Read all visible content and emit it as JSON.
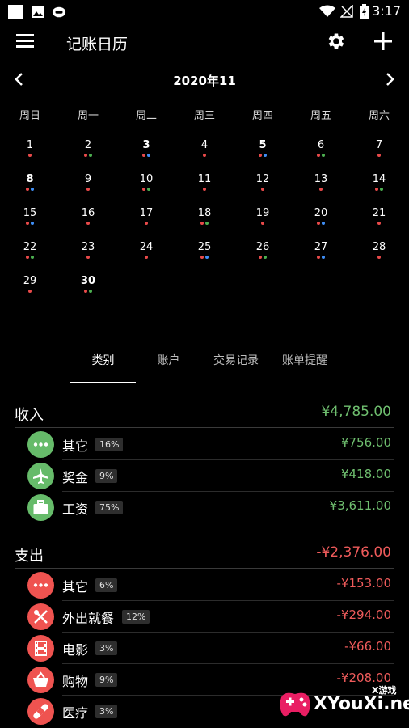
{
  "status_bar": {
    "time": "3:17"
  },
  "header": {
    "title": "记账日历"
  },
  "month_label": "2020年11",
  "weekdays": [
    "周日",
    "周一",
    "周二",
    "周三",
    "周四",
    "周五",
    "周六"
  ],
  "calendar": [
    {
      "day": "1",
      "dots": [
        "r"
      ]
    },
    {
      "day": "2",
      "dots": [
        "r",
        "g"
      ]
    },
    {
      "day": "3",
      "dots": [
        "r",
        "b"
      ],
      "bold": true
    },
    {
      "day": "4",
      "dots": [
        "r"
      ]
    },
    {
      "day": "5",
      "dots": [
        "r",
        "b"
      ],
      "bold": true
    },
    {
      "day": "6",
      "dots": [
        "r",
        "g"
      ]
    },
    {
      "day": "7",
      "dots": [
        "r"
      ]
    },
    {
      "day": "8",
      "dots": [
        "r",
        "b"
      ],
      "bold": true
    },
    {
      "day": "9",
      "dots": [
        "r"
      ]
    },
    {
      "day": "10",
      "dots": [
        "r",
        "g"
      ]
    },
    {
      "day": "11",
      "dots": [
        "r"
      ]
    },
    {
      "day": "12",
      "dots": [
        "r"
      ]
    },
    {
      "day": "13",
      "dots": [
        "r"
      ]
    },
    {
      "day": "14",
      "dots": [
        "r",
        "g"
      ]
    },
    {
      "day": "15",
      "dots": [
        "r",
        "b"
      ]
    },
    {
      "day": "16",
      "dots": [
        "r"
      ]
    },
    {
      "day": "17",
      "dots": [
        "r"
      ]
    },
    {
      "day": "18",
      "dots": [
        "r",
        "g"
      ]
    },
    {
      "day": "19",
      "dots": [
        "r"
      ]
    },
    {
      "day": "20",
      "dots": [
        "r",
        "b"
      ]
    },
    {
      "day": "21",
      "dots": [
        "r"
      ]
    },
    {
      "day": "22",
      "dots": [
        "r",
        "g"
      ]
    },
    {
      "day": "23",
      "dots": [
        "r"
      ]
    },
    {
      "day": "24",
      "dots": [
        "r"
      ]
    },
    {
      "day": "25",
      "dots": [
        "r",
        "b"
      ]
    },
    {
      "day": "26",
      "dots": [
        "r",
        "g"
      ]
    },
    {
      "day": "27",
      "dots": [
        "r",
        "b"
      ]
    },
    {
      "day": "28",
      "dots": [
        "r"
      ]
    },
    {
      "day": "29",
      "dots": [
        "r"
      ]
    },
    {
      "day": "30",
      "dots": [
        "r",
        "g"
      ],
      "bold": true
    }
  ],
  "tabs": [
    "类别",
    "账户",
    "交易记录",
    "账单提醒"
  ],
  "income": {
    "title": "收入",
    "total": "¥4,785.00",
    "items": [
      {
        "name": "其它",
        "pct": "16%",
        "amount": "¥756.00",
        "icon": "more-icon"
      },
      {
        "name": "奖金",
        "pct": "9%",
        "amount": "¥418.00",
        "icon": "airplane-icon"
      },
      {
        "name": "工资",
        "pct": "75%",
        "amount": "¥3,611.00",
        "icon": "briefcase-icon"
      }
    ]
  },
  "expense": {
    "title": "支出",
    "total": "-¥2,376.00",
    "items": [
      {
        "name": "其它",
        "pct": "6%",
        "amount": "-¥153.00",
        "icon": "more-icon"
      },
      {
        "name": "外出就餐",
        "pct": "12%",
        "amount": "-¥294.00",
        "icon": "utensils-icon"
      },
      {
        "name": "电影",
        "pct": "3%",
        "amount": "-¥66.00",
        "icon": "film-icon"
      },
      {
        "name": "购物",
        "pct": "9%",
        "amount": "-¥208.00",
        "icon": "basket-icon"
      },
      {
        "name": "医疗",
        "pct": "3%",
        "amount": "",
        "icon": "bandage-icon"
      }
    ]
  },
  "watermark": {
    "brand": "XYouXi.net",
    "tag": "X游戏"
  },
  "colors": {
    "income": "#6fbf6f",
    "expense": "#ef5b5b",
    "dot_red": "#e84a4a",
    "dot_green": "#4caf50",
    "dot_blue": "#3f8ef5"
  }
}
